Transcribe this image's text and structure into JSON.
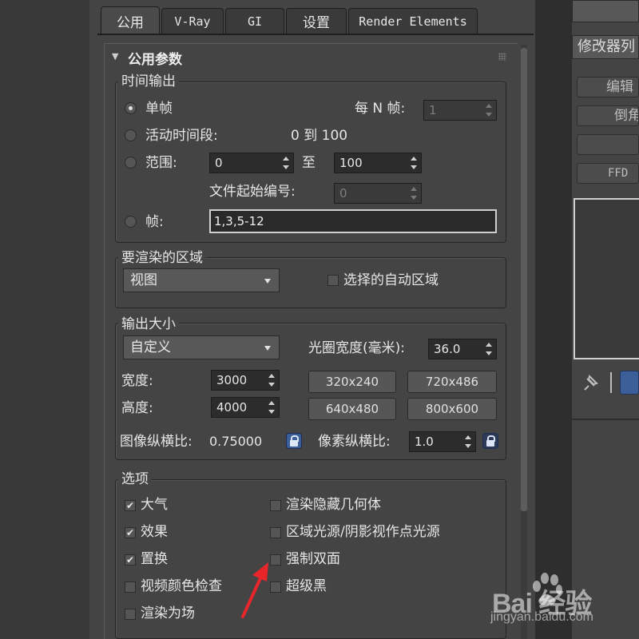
{
  "tabs": [
    {
      "label": "公用"
    },
    {
      "label": "V-Ray"
    },
    {
      "label": "GI"
    },
    {
      "label": "设置"
    },
    {
      "label": "Render Elements"
    }
  ],
  "rollout_title": "公用参数",
  "time_output": {
    "legend": "时间输出",
    "single_label": "单帧",
    "every_n_label": "每 N 帧:",
    "every_n_value": "1",
    "active_label": "活动时间段:",
    "active_range": "0 到 100",
    "range_label": "范围:",
    "range_from": "0",
    "range_to_label": "至",
    "range_to": "100",
    "file_start_label": "文件起始编号:",
    "file_start_value": "0",
    "frames_label": "帧:",
    "frames_value": "1,3,5-12"
  },
  "render_area": {
    "legend": "要渲染的区域",
    "dropdown": "视图",
    "auto_region_label": "选择的自动区域"
  },
  "output_size": {
    "legend": "输出大小",
    "preset": "自定义",
    "aperture_label": "光圈宽度(毫米):",
    "aperture_value": "36.0",
    "width_label": "宽度:",
    "width_value": "3000",
    "height_label": "高度:",
    "height_value": "4000",
    "presets": [
      "320x240",
      "720x486",
      "640x480",
      "800x600"
    ],
    "image_aspect_label": "图像纵横比:",
    "image_aspect_value": "0.75000",
    "pixel_aspect_label": "像素纵横比:",
    "pixel_aspect_value": "1.0"
  },
  "options": {
    "legend": "选项",
    "left": [
      {
        "label": "大气",
        "checked": true
      },
      {
        "label": "效果",
        "checked": true
      },
      {
        "label": "置换",
        "checked": true
      },
      {
        "label": "视频颜色检查",
        "checked": false
      },
      {
        "label": "渲染为场",
        "checked": false
      }
    ],
    "right": [
      {
        "label": "渲染隐藏几何体",
        "checked": false
      },
      {
        "label": "区域光源/阴影视作点光源",
        "checked": false
      },
      {
        "label": "强制双面",
        "checked": false
      },
      {
        "label": "超级黑",
        "checked": false
      }
    ]
  },
  "right_panel": {
    "modifier_list": "修改器列",
    "buttons": [
      "编辑",
      "倒角",
      "",
      "FFD"
    ]
  },
  "watermark": {
    "brand": "Bai 经验",
    "url": "jingyan.baidu.com"
  },
  "colors": {
    "annotation_arrow": "#e8262a",
    "lock_button": "#3c5f9a"
  }
}
